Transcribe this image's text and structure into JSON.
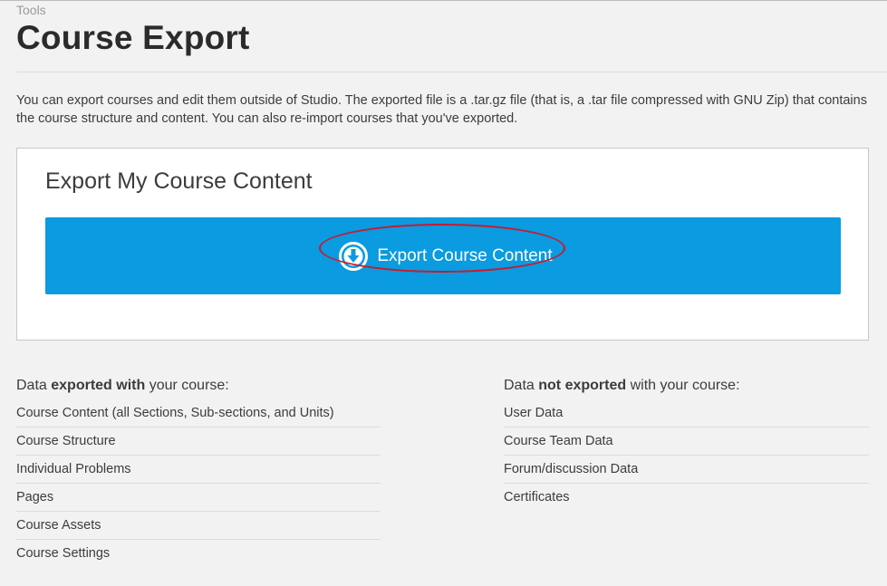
{
  "breadcrumb": "Tools",
  "page_title": "Course Export",
  "intro_text": "You can export courses and edit them outside of Studio. The exported file is a .tar.gz file (that is, a .tar file compressed with GNU Zip) that contains the course structure and content. You can also re-import courses that you've exported.",
  "export_card": {
    "title": "Export My Course Content",
    "button_label": "Export Course Content",
    "button_icon": "download-circle-icon",
    "button_color": "#0a9be0",
    "highlight_color": "#c91a2c"
  },
  "exported": {
    "heading_prefix": "Data ",
    "heading_bold": "exported with",
    "heading_suffix": " your course:",
    "items": [
      "Course Content (all Sections, Sub-sections, and Units)",
      "Course Structure",
      "Individual Problems",
      "Pages",
      "Course Assets",
      "Course Settings"
    ]
  },
  "not_exported": {
    "heading_prefix": "Data ",
    "heading_bold": "not exported",
    "heading_suffix": " with your course:",
    "items": [
      "User Data",
      "Course Team Data",
      "Forum/discussion Data",
      "Certificates"
    ]
  }
}
